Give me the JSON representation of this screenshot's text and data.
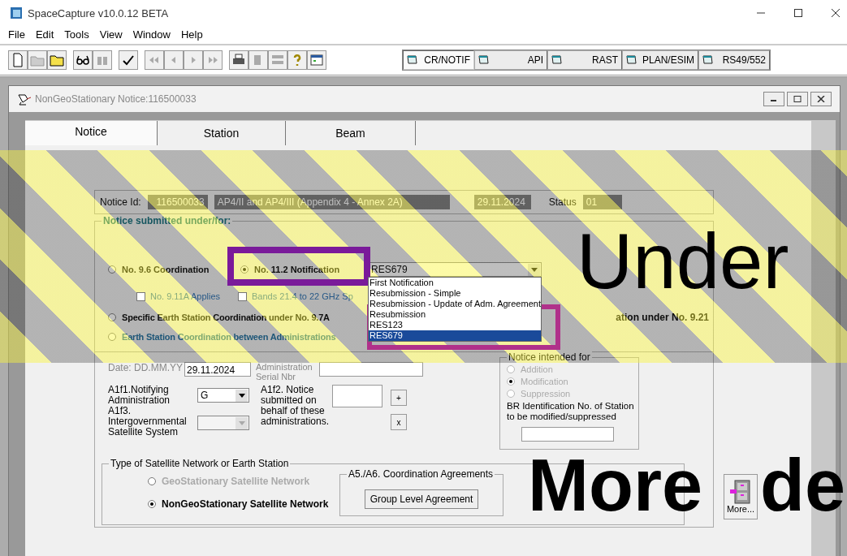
{
  "window": {
    "title": "SpaceCapture v10.0.12 BETA"
  },
  "menu": [
    "File",
    "Edit",
    "Tools",
    "View",
    "Window",
    "Help"
  ],
  "module_tabs": [
    {
      "label": "CR/NOTIF",
      "selected": true
    },
    {
      "label": "API",
      "selected": false
    },
    {
      "label": "RAST",
      "selected": false
    },
    {
      "label": "PLAN/ESIM",
      "selected": false
    },
    {
      "label": "RS49/552",
      "selected": false
    }
  ],
  "notice_window": {
    "title": "NonGeoStationary Notice:116500033",
    "tabs": [
      {
        "label": "Notice",
        "selected": true
      },
      {
        "label": "Station",
        "selected": false
      },
      {
        "label": "Beam",
        "selected": false
      }
    ],
    "header": {
      "id_label": "Notice Id:",
      "id": "116500033",
      "appendix": "AP4/II and AP4/III (Appendix 4 - Annex 2A)",
      "date": "29.11.2024",
      "status_label": "Status",
      "status": "01"
    },
    "submitted": {
      "title": "Notice submitted under/for:",
      "coordination": {
        "label": "No. 9.6   Coordination",
        "selected": false
      },
      "notification": {
        "label": "No. 11.2   Notification",
        "selected": true
      },
      "notification_value": "RES679",
      "dropdown_options": [
        {
          "label": "First Notification",
          "selected": false
        },
        {
          "label": "Resubmission - Simple",
          "selected": false
        },
        {
          "label": "Resubmission - Update of Adm. Agreement",
          "selected": false
        },
        {
          "label": "Resubmission",
          "selected": false
        },
        {
          "label": "RES123",
          "selected": false
        },
        {
          "label": "RES679",
          "selected": true
        }
      ],
      "checkboxes": [
        {
          "label": "No. 9.11A Applies",
          "checked": false
        },
        {
          "label": "Bands 21.4 to 22 GHz Sp",
          "checked": false
        }
      ],
      "specific": {
        "label": "Specific Earth Station Coordination under No. 9.7A",
        "selected": false,
        "trailing": "ation under No. 9.21"
      },
      "between": {
        "label": "Earth Station Coordination between Administrations",
        "selected": false
      }
    },
    "date_label": "Date:  DD.MM.YY",
    "date": "29.11.2024",
    "serial_label": "Administration Serial Nbr",
    "a1f1_label": "A1f1.Notifying Administration",
    "a1f1_value": "G",
    "a1f3_label": "A1f3. Intergovernmental Satellite System",
    "a1f2_label": "A1f2. Notice submitted on behalf of these administrations.",
    "add_button": "+",
    "remove_button": "x",
    "intended": {
      "title": "Notice intended for",
      "options": [
        {
          "label": "Addition",
          "selected": false
        },
        {
          "label": "Modification",
          "selected": true
        },
        {
          "label": "Suppression",
          "selected": false
        }
      ],
      "br_label": "BR Identification No. of Station to be modified/suppressed"
    },
    "network_type": {
      "title": "Type of Satellite Network or Earth Station",
      "options": [
        {
          "label": "GeoStationary Satellite Network",
          "selected": false,
          "disabled": true
        },
        {
          "label": "NonGeoStationary Satellite Network",
          "selected": true,
          "disabled": false
        }
      ]
    },
    "agreements": {
      "title": "A5./A6. Coordination Agreements",
      "button": "Group Level Agreement"
    },
    "more_button": "More..."
  },
  "overlay": {
    "heading": "Under",
    "subheading_words": [
      "More",
      "de"
    ]
  }
}
